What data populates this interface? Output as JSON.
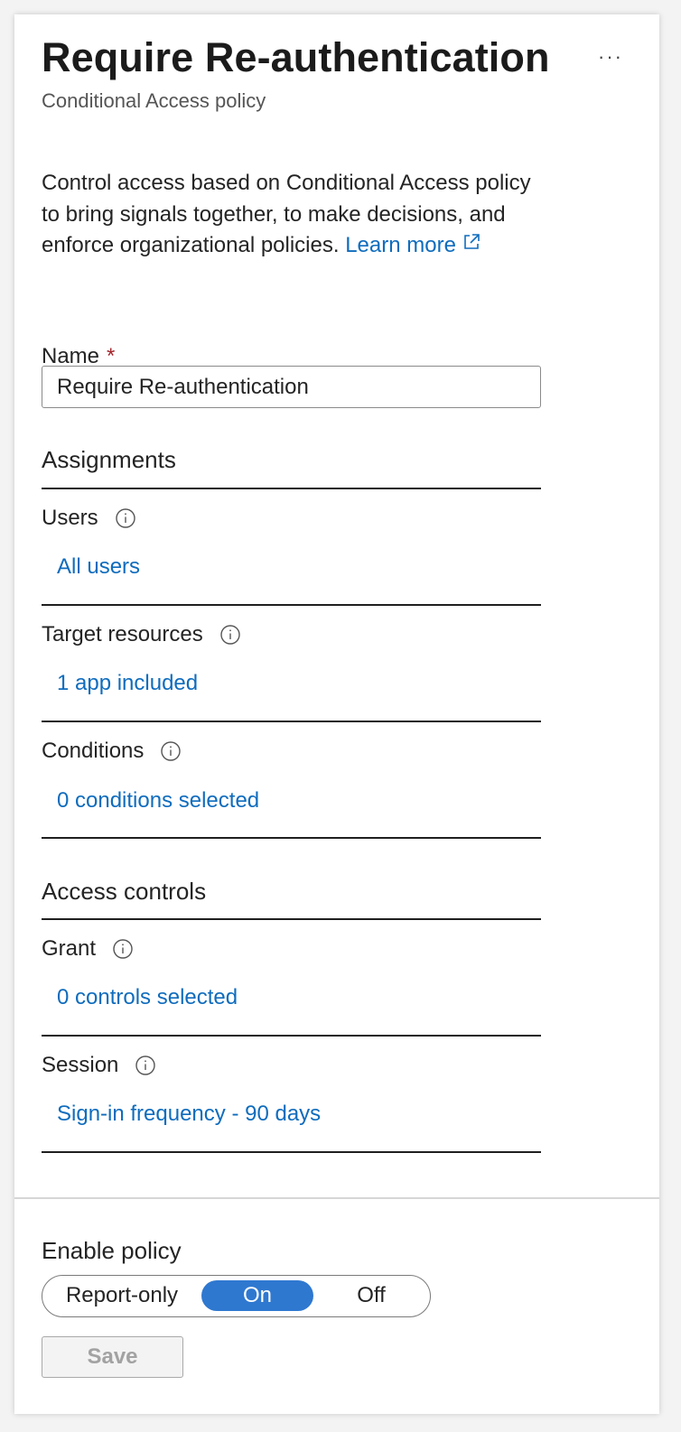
{
  "header": {
    "title": "Require Re-authentication",
    "subtitle": "Conditional Access policy",
    "more_label": "···"
  },
  "description": {
    "text": "Control access based on Conditional Access policy to bring signals together, to make decisions, and enforce organizational policies.",
    "learn_more": "Learn more"
  },
  "name_field": {
    "label": "Name",
    "required_mark": "*",
    "value": "Require Re-authentication"
  },
  "assignments": {
    "heading": "Assignments",
    "users": {
      "label": "Users",
      "link": "All users"
    },
    "target_resources": {
      "label": "Target resources",
      "link": "1 app included"
    },
    "conditions": {
      "label": "Conditions",
      "link": "0 conditions selected"
    }
  },
  "access_controls": {
    "heading": "Access controls",
    "grant": {
      "label": "Grant",
      "link": "0 controls selected"
    },
    "session": {
      "label": "Session",
      "link": "Sign-in frequency - 90 days"
    }
  },
  "enable_policy": {
    "label": "Enable policy",
    "options": [
      "Report-only",
      "On",
      "Off"
    ],
    "selected": "On"
  },
  "save_label": "Save",
  "colors": {
    "link": "#0f6cbd",
    "toggle_selected": "#2f78d0",
    "required": "#a4262c"
  }
}
